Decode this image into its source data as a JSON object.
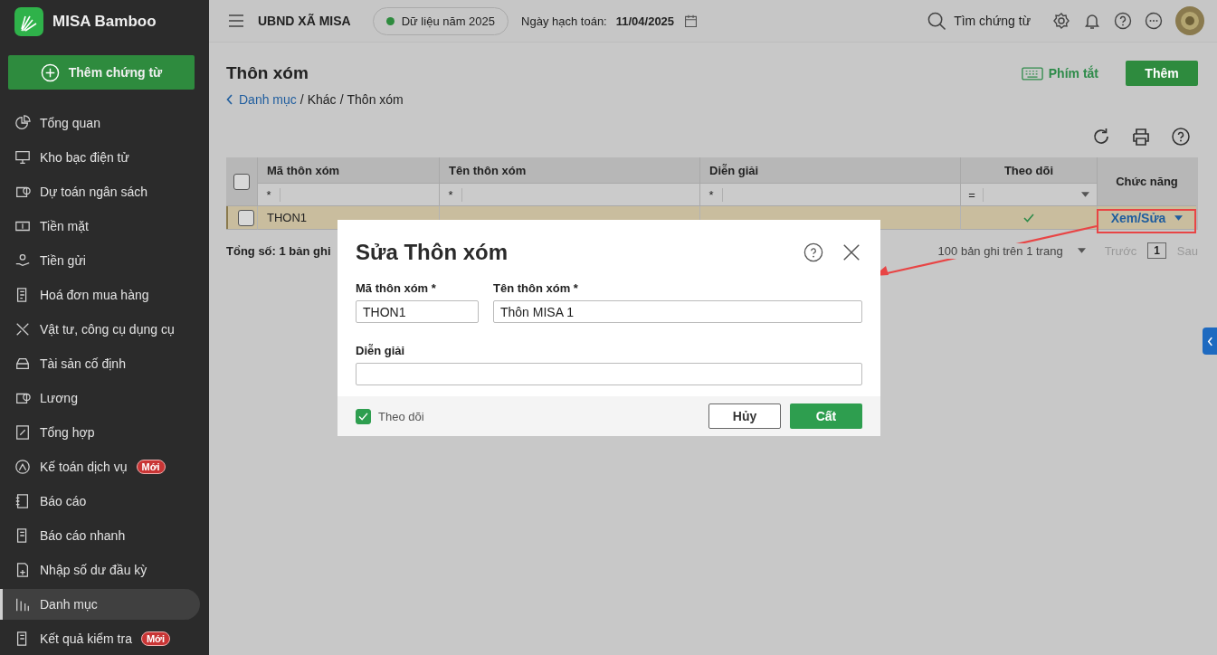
{
  "app": {
    "name": "MISA Bamboo",
    "add_voucher_button": "Thêm chứng từ"
  },
  "sidebar": {
    "items": [
      {
        "label": "Tổng quan",
        "selected": false
      },
      {
        "label": "Kho bạc điện tử",
        "selected": false
      },
      {
        "label": "Dự toán ngân sách",
        "selected": false
      },
      {
        "label": "Tiền mặt",
        "selected": false
      },
      {
        "label": "Tiền gửi",
        "selected": false
      },
      {
        "label": "Hoá đơn mua hàng",
        "selected": false
      },
      {
        "label": "Vật tư, công cụ dụng cụ",
        "selected": false
      },
      {
        "label": "Tài sản cố định",
        "selected": false
      },
      {
        "label": "Lương",
        "selected": false
      },
      {
        "label": "Tổng hợp",
        "selected": false
      },
      {
        "label": "Kế toán dịch vụ",
        "badge": "Mới",
        "selected": false
      },
      {
        "label": "Báo cáo",
        "selected": false
      },
      {
        "label": "Báo cáo nhanh",
        "selected": false
      },
      {
        "label": "Nhập số dư đầu kỳ",
        "selected": false
      },
      {
        "label": "Danh mục",
        "selected": true
      },
      {
        "label": "Kết quả kiểm tra",
        "badge": "Mới",
        "selected": false
      }
    ]
  },
  "topbar": {
    "organization": "UBND XÃ MISA",
    "data_year": "Dữ liệu năm 2025",
    "posting_date_label": "Ngày hạch toán:",
    "posting_date": "11/04/2025",
    "search": "Tìm chứng từ"
  },
  "page": {
    "title": "Thôn xóm",
    "shortcut_button": "Phím tắt",
    "add_button": "Thêm",
    "breadcrumb": [
      {
        "label": "Danh mục",
        "link": true
      },
      {
        "separator": "/",
        "label": "Khác",
        "link": false
      },
      {
        "separator": "/",
        "label": "Thôn xóm",
        "link": false
      }
    ]
  },
  "table": {
    "select_all_checked": false,
    "columns": [
      {
        "label": "Mã thôn xóm",
        "filter": "*",
        "kind": "text"
      },
      {
        "label": "Tên thôn xóm",
        "filter": "*",
        "kind": "text"
      },
      {
        "label": "Diễn giải",
        "filter": "*",
        "kind": "text"
      },
      {
        "label": "Theo dõi",
        "filter": "=",
        "kind": "check"
      }
    ],
    "action_column": "Chức năng",
    "rows": [
      {
        "code": "THON1",
        "tracked": true,
        "checked": false,
        "selected": true,
        "action": "Xem/Sửa"
      }
    ],
    "total": "Tổng số: 1 bản ghi",
    "page_size": "100 bản ghi trên 1 trang",
    "prev": "Trước",
    "page": "1",
    "next": "Sau"
  },
  "dialog": {
    "title": "Sửa Thôn xóm",
    "fields": [
      {
        "label": "Mã thôn xóm *",
        "value": "THON1"
      },
      {
        "label": "Tên thôn xóm *",
        "value": "Thôn MISA 1"
      },
      {
        "label": "Diễn giải"
      }
    ],
    "tracked": {
      "label": "Theo dõi",
      "checked": true
    },
    "cancel_button": "Hủy",
    "save_button": "Cất"
  }
}
